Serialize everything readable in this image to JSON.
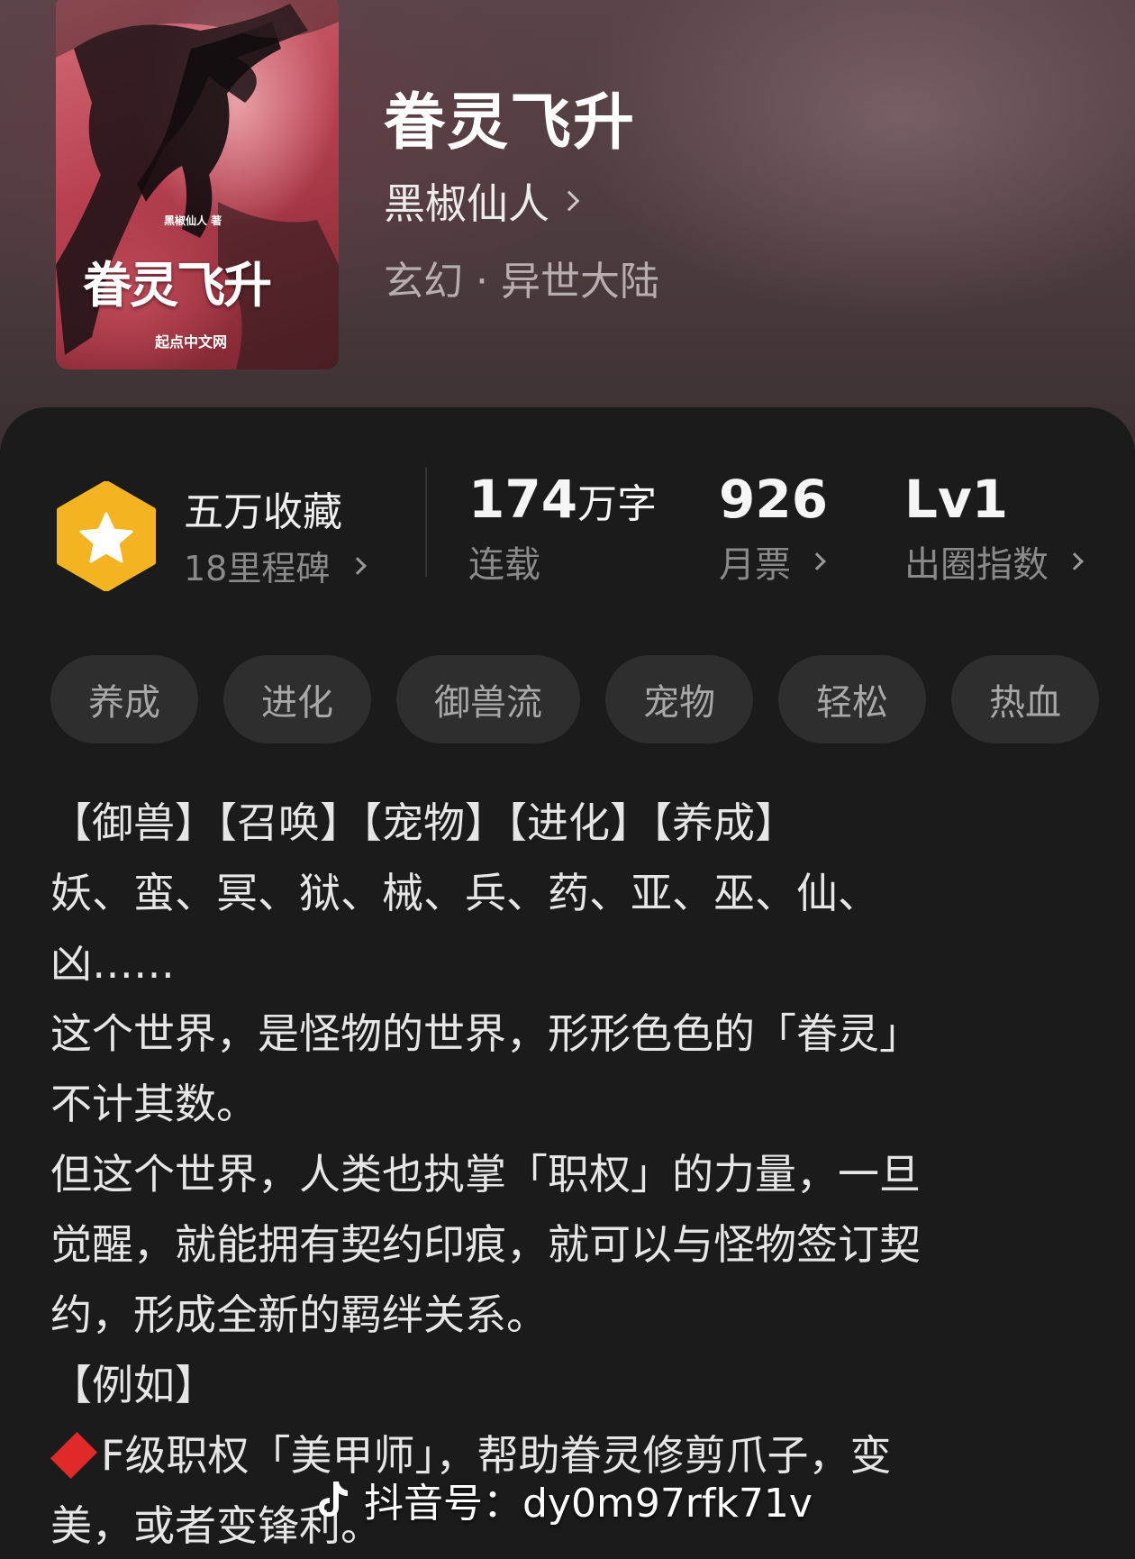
{
  "book": {
    "cover_author": "黑椒仙人 著",
    "cover_title": "眷灵飞升",
    "cover_publisher": "起点中文网",
    "title": "眷灵飞升",
    "author": "黑椒仙人",
    "genre": "玄幻 · 异世大陆"
  },
  "stats": {
    "favorites_title": "五万收藏",
    "favorites_sub": "18里程碑",
    "word_count_num": "174",
    "word_count_unit": "万字",
    "word_count_label": "连载",
    "monthly_votes": "926",
    "monthly_votes_label": "月票",
    "level": "Lv1",
    "level_label": "出圈指数"
  },
  "tags": [
    "养成",
    "进化",
    "御兽流",
    "宠物",
    "轻松",
    "热血"
  ],
  "description": [
    "【御兽】【召唤】【宠物】【进化】【养成】",
    "妖、蛮、冥、狱、械、兵、药、亚、巫、仙、",
    "凶……",
    "这个世界，是怪物的世界，形形色色的「眷灵」",
    "不计其数。",
    "但这个世界，人类也执掌「职权」的力量，一旦",
    "觉醒，就能拥有契约印痕，就可以与怪物签订契",
    "约，形成全新的羁绊关系。",
    "【例如】",
    "F级职权「美甲师」，帮助眷灵修剪爪子，变",
    "美，或者变锋利。"
  ],
  "watermark": "抖音号：dy0m97rfk71v",
  "colors": {
    "accent_badge": "#f4b321",
    "diamond": "#e02a2a",
    "card_bg": "#1b1b1b",
    "tag_bg": "#2e2e2e"
  }
}
